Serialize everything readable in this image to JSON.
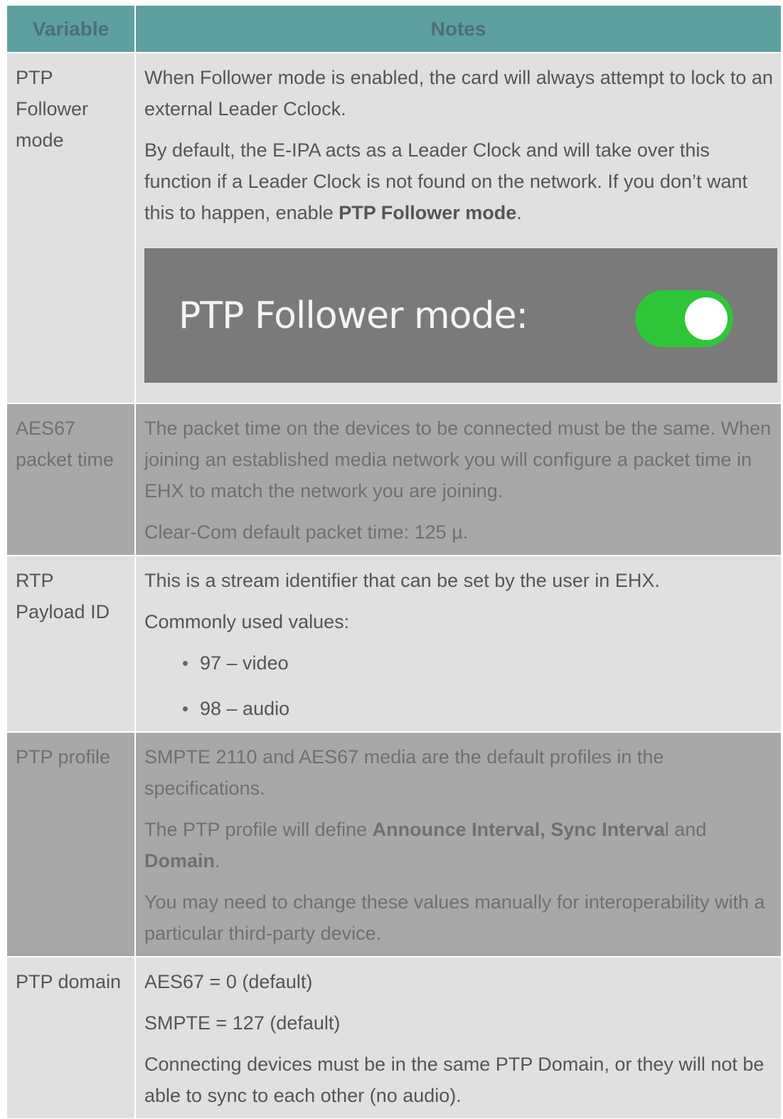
{
  "header": {
    "variable": "Variable",
    "notes": "Notes"
  },
  "rows": {
    "follower": {
      "name": "PTP Follower mode",
      "p1": "When Follower mode is enabled, the card will always attempt to lock to an external Leader Cclock.",
      "p2_pre": "By default, the E-IPA acts as a Leader Clock and will take over this function if a Leader Clock is not found on the network. If you don’t want this to happen, enable ",
      "p2_bold": "PTP Follower mode",
      "p2_post": ".",
      "screenshot_label": "PTP Follower mode:",
      "toggle_on": true,
      "toggle_color": "#2fc639"
    },
    "aes67": {
      "name": "AES67 packet time",
      "p1": "The packet time on the devices to be connected must be the same. When joining an established media network you will configure a packet time in EHX to match the network you are joining.",
      "p2": "Clear-Com default packet time: 125 µ."
    },
    "rtp": {
      "name": "RTP Payload ID",
      "p1": "This is a stream identifier that can be set by the user in EHX.",
      "p2": "Commonly used values:",
      "items": [
        "97 – video",
        "98 – audio"
      ]
    },
    "profile": {
      "name": "PTP profile",
      "p1": "SMPTE 2110 and AES67 media are the default profiles in the specifications.",
      "p2_pre": "The PTP profile will define ",
      "p2_bold1": "Announce Interval, Sync Interva",
      "p2_mid": "l and ",
      "p2_bold2": "Domain",
      "p2_post": ".",
      "p3": "You may need to change these values manually for interoperability with a particular third-party device."
    },
    "domain": {
      "name": "PTP domain",
      "p1": "AES67 = 0 (default)",
      "p2": "SMPTE = 127 (default)",
      "p3": "Connecting devices must be in the same PTP Domain, or they will not be able to sync to each other (no audio)."
    }
  },
  "colors": {
    "header_bg": "#5e9fa0",
    "row_light": "#e0e0e0",
    "row_dark": "#a8a8a8"
  }
}
